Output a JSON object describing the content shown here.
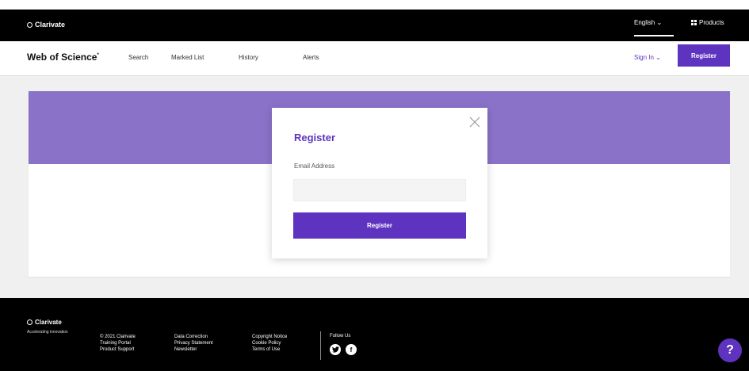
{
  "topbar": {
    "brand": "Clarivate",
    "language": "English",
    "products": "Products"
  },
  "navbar": {
    "logo": "Web of Science",
    "items": [
      "Search",
      "Marked List",
      "History",
      "Alerts"
    ],
    "sign_in": "Sign In",
    "register": "Register"
  },
  "modal": {
    "title": "Register",
    "email_label": "Email Address",
    "email_value": "",
    "submit": "Register"
  },
  "footer": {
    "brand": "Clarivate",
    "tagline": "Accelerating innovation",
    "columns": [
      [
        "© 2021 Clarivate",
        "Training Portal",
        "Product Support"
      ],
      [
        "Data Correction",
        "Privacy Statement",
        "Newsletter"
      ],
      [
        "Copyright Notice",
        "Cookie Policy",
        "Terms of Use"
      ]
    ],
    "follow_us": "Follow Us"
  },
  "help": {
    "glyph": "?"
  },
  "colors": {
    "accent": "#5e33bf",
    "banner": "#8a72c9",
    "topbar": "#000000"
  }
}
